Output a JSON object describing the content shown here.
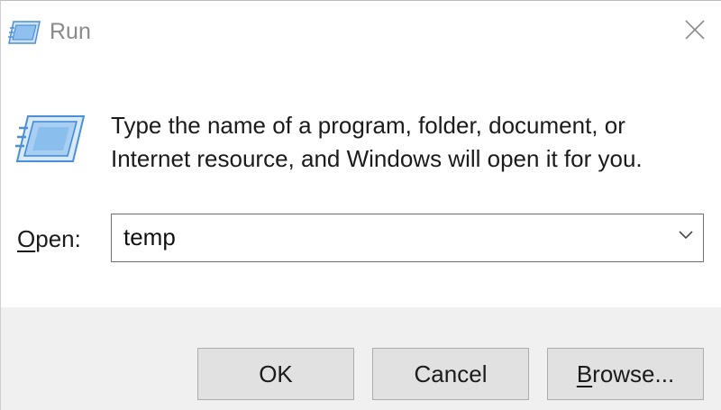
{
  "window": {
    "title": "Run",
    "icon": "run-icon",
    "close_icon": "close-icon"
  },
  "body": {
    "icon": "run-icon",
    "description_line1": "Type the name of a program, folder, document, or",
    "description_line2": "Internet resource, and Windows will open it for you."
  },
  "open_field": {
    "label_mnemonic": "O",
    "label_rest": "pen:",
    "value": "temp",
    "dropdown_icon": "chevron-down-icon"
  },
  "buttons": {
    "ok_label": "OK",
    "cancel_label": "Cancel",
    "browse_mnemonic": "B",
    "browse_rest": "rowse..."
  },
  "colors": {
    "footer_bg": "#f0f0f0",
    "button_bg": "#e1e1e1",
    "icon_blue": "#4a90d9"
  }
}
